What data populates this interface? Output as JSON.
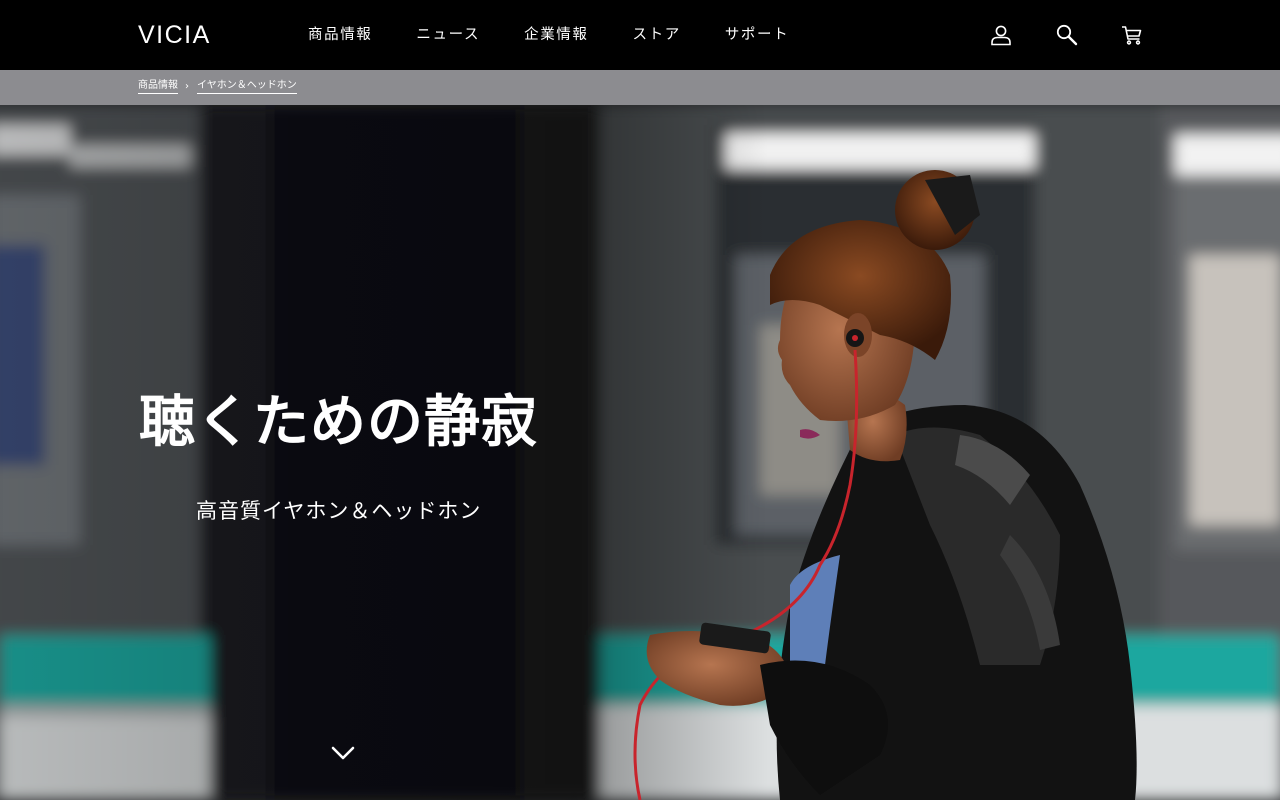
{
  "brand": {
    "logo": "VICIA"
  },
  "nav": {
    "items": [
      {
        "label": "商品情報"
      },
      {
        "label": "ニュース"
      },
      {
        "label": "企業情報"
      },
      {
        "label": "ストア"
      },
      {
        "label": "サポート"
      }
    ]
  },
  "tools": {
    "icons": [
      "user-icon",
      "search-icon",
      "cart-icon"
    ]
  },
  "breadcrumb": {
    "items": [
      {
        "label": "商品情報"
      },
      {
        "label": "イヤホン＆ヘッドホン"
      }
    ],
    "separator": "›"
  },
  "hero": {
    "headline": "聴くための静寂",
    "subline": "高音質イヤホン＆ヘッドホン",
    "scroll_icon": "chevron-down-icon"
  },
  "colors": {
    "header_bg": "#000000",
    "breadcrumb_bg": "#8c8c90",
    "text": "#ffffff",
    "train_stripe": "#1aa89f",
    "cable_red": "#c8242c"
  }
}
